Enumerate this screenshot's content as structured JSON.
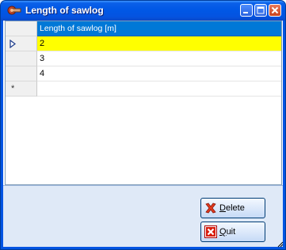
{
  "window": {
    "title": "Length of sawlog",
    "controls": [
      "minimize",
      "maximize",
      "close"
    ]
  },
  "grid": {
    "column_header": "Length of sawlog [m]",
    "rows": [
      {
        "value": "2",
        "selected": true,
        "current": true
      },
      {
        "value": "3",
        "selected": false,
        "current": false
      },
      {
        "value": "4",
        "selected": false,
        "current": false
      }
    ],
    "new_row_marker": "*",
    "colors": {
      "header": "#0078d7",
      "selected_row": "#ffff00"
    }
  },
  "buttons": {
    "delete": {
      "accel": "D",
      "rest": "elete",
      "icon": "delete-x-icon"
    },
    "quit": {
      "accel": "Q",
      "rest": "uit",
      "icon": "quit-x-icon"
    }
  }
}
